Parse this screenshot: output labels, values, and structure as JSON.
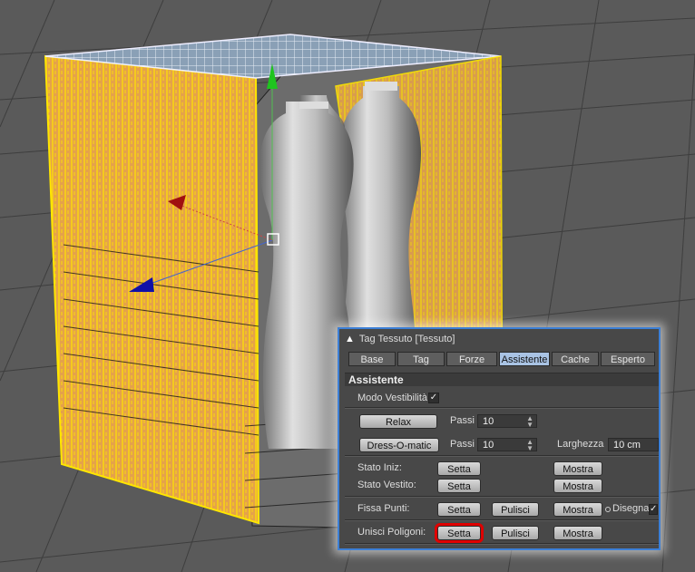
{
  "panel": {
    "title": "Tag Tessuto [Tessuto]",
    "tabs": [
      "Base",
      "Tag",
      "Forze",
      "Assistente",
      "Cache",
      "Esperto"
    ],
    "active_tab": "Assistente",
    "section_title": "Assistente",
    "modo_vestibilita": {
      "label": "Modo Vestibilità",
      "checked": true
    },
    "relax": {
      "button": "Relax",
      "passi_label": "Passi",
      "passi_value": "10"
    },
    "dressomatic": {
      "button": "Dress-O-matic",
      "passi_label": "Passi",
      "passi_value": "10",
      "larghezza_label": "Larghezza",
      "larghezza_value": "10 cm"
    },
    "stato_iniz": {
      "label": "Stato Iniz:",
      "setta": "Setta",
      "mostra": "Mostra"
    },
    "stato_vestito": {
      "label": "Stato Vestito:",
      "setta": "Setta",
      "mostra": "Mostra"
    },
    "fissa_punti": {
      "label": "Fissa Punti:",
      "setta": "Setta",
      "pulisci": "Pulisci",
      "mostra": "Mostra",
      "disegna": "Disegna"
    },
    "unisci_poligoni": {
      "label": "Unisci Poligoni:",
      "setta": "Setta",
      "pulisci": "Pulisci",
      "mostra": "Mostra"
    }
  },
  "colors": {
    "accent": "#3c7fd6",
    "highlight": "#e00000",
    "active_tab": "#a9c3e4",
    "cloth_wire": "#f2d000"
  },
  "icons": {
    "title_icon": "shirt-icon",
    "spinner": "spinner-arrows-icon",
    "checkmark": "checkmark-icon"
  }
}
